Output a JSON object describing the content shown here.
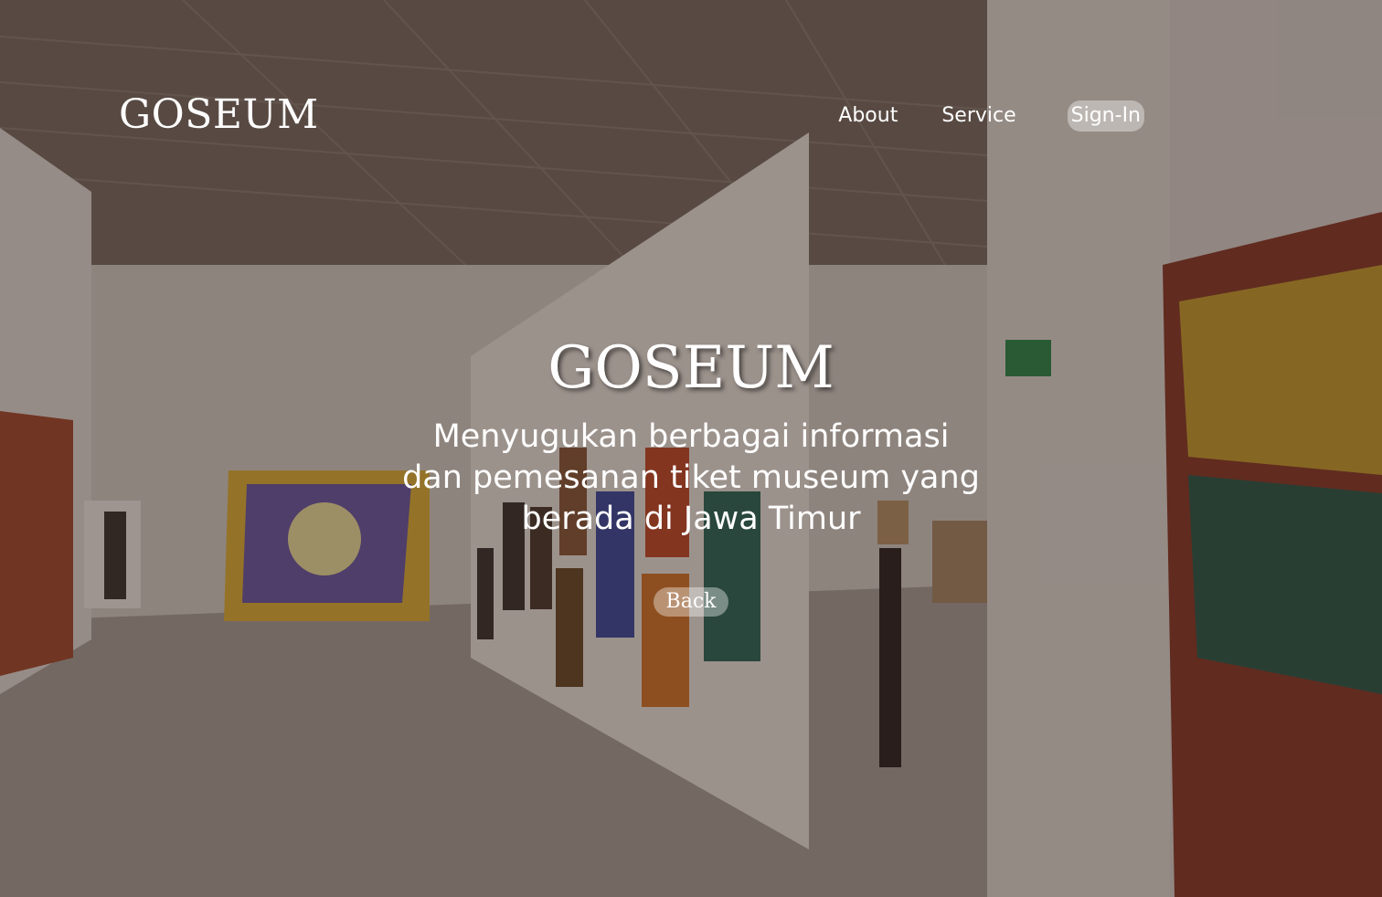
{
  "header": {
    "logo": "GOSEUM",
    "nav": {
      "about": "About",
      "service": "Service",
      "signin": "Sign-In"
    }
  },
  "hero": {
    "title": "GOSEUM",
    "tagline": "Menyugukan berbagai informasi dan pemesanan tiket museum yang berada di Jawa Timur",
    "back_label": "Back"
  },
  "background": {
    "icon": "art-gallery-photo",
    "overlay_color": "#281814"
  }
}
